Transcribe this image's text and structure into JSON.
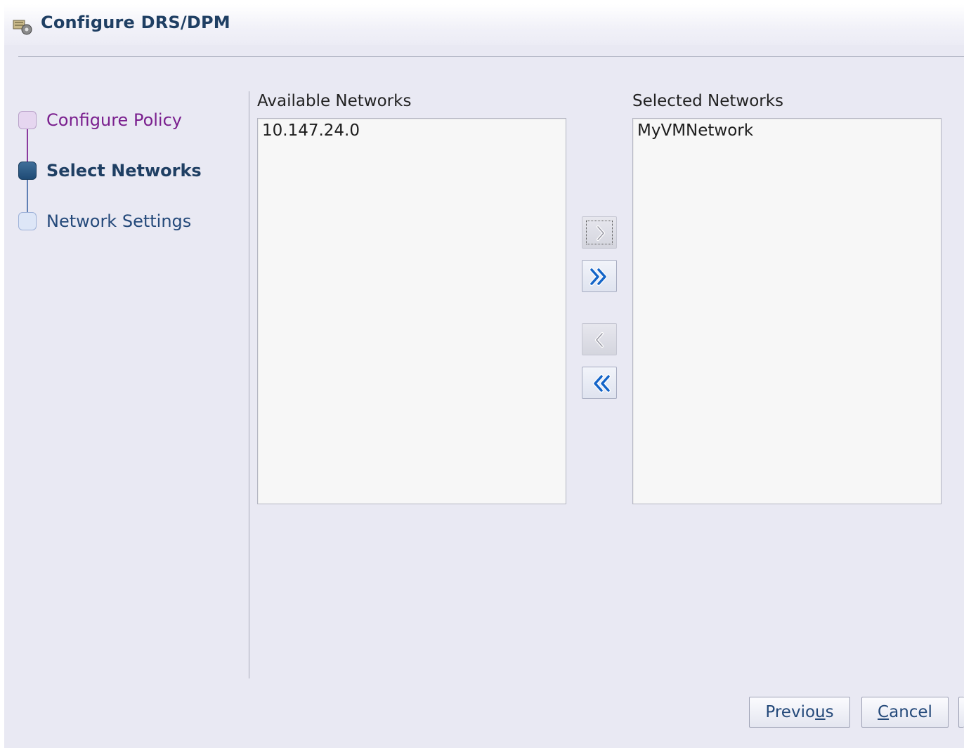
{
  "dialog": {
    "title": "Configure DRS/DPM",
    "icon": "host-settings-icon"
  },
  "steps": [
    {
      "label": "Configure Policy",
      "state": "completed"
    },
    {
      "label": "Select Networks",
      "state": "current"
    },
    {
      "label": "Network Settings",
      "state": "upcoming"
    }
  ],
  "available": {
    "heading": "Available Networks",
    "items": [
      "10.147.24.0"
    ]
  },
  "selected": {
    "heading": "Selected Networks",
    "items": [
      "MyVMNetwork"
    ]
  },
  "move_buttons": [
    {
      "icon": "move-right-icon",
      "enabled": false
    },
    {
      "icon": "move-all-right-icon",
      "enabled": true
    },
    {
      "icon": "move-left-icon",
      "enabled": false
    },
    {
      "icon": "move-all-left-icon",
      "enabled": true
    }
  ],
  "footer": {
    "previous": {
      "before": "Previo",
      "mnemonic": "u",
      "after": "s"
    },
    "cancel": {
      "before": "",
      "mnemonic": "C",
      "after": "ancel"
    }
  },
  "colors": {
    "completed_step": "#7a1f8e",
    "current_step": "#1f3f63",
    "upcoming_step": "#24497a",
    "arrow_blue": "#1565c8"
  }
}
